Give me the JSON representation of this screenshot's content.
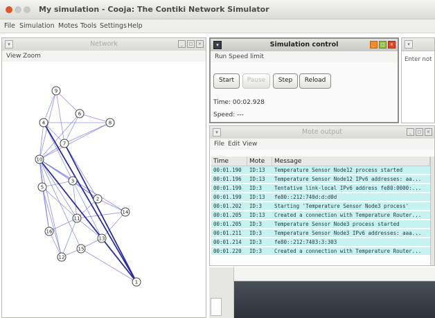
{
  "window": {
    "title": "My simulation - Cooja: The Contiki Network Simulator",
    "menu": [
      "File",
      "Simulation",
      "Motes",
      "Tools",
      "Settings",
      "Help"
    ]
  },
  "network": {
    "title": "Network",
    "menu": [
      "View",
      "Zoom"
    ],
    "node_labels": [
      "9",
      "6",
      "8",
      "4",
      "7",
      "10",
      "5",
      "3",
      "2",
      "11",
      "14",
      "16",
      "13",
      "12",
      "15",
      "1"
    ]
  },
  "simulation_control": {
    "title": "Simulation control",
    "menu": [
      "Run",
      "Speed limit"
    ],
    "buttons": {
      "start": "Start",
      "pause": "Pause",
      "step": "Step",
      "reload": "Reload"
    },
    "time": "Time: 00:02.928",
    "speed": "Speed: ---"
  },
  "notes": {
    "placeholder": "Enter not"
  },
  "mote_output": {
    "title": "Mote output",
    "menu": [
      "File",
      "Edit",
      "View"
    ],
    "columns": [
      "Time",
      "Mote",
      "Message"
    ],
    "rows": [
      [
        "00:01.190",
        "ID:13",
        "Temperature Sensor Node12 process started"
      ],
      [
        "00:01.196",
        "ID:13",
        "Temperature Sensor Node12 IPv6 addresses: aa..."
      ],
      [
        "00:01.199",
        "ID:3",
        "Tentative link-local IPv6 address fe80:0000:..."
      ],
      [
        "00:01.199",
        "ID:13",
        "fe80::212:740d:d:d0d"
      ],
      [
        "00:01.202",
        "ID:3",
        "Starting 'Temperature Sensor Node3 process'"
      ],
      [
        "00:01.205",
        "ID:13",
        "Created a connection with Temperature Router..."
      ],
      [
        "00:01.205",
        "ID:3",
        "Temperature Sensor Node3 process started"
      ],
      [
        "00:01.211",
        "ID:3",
        "Temperature Sensor Node3 IPv6 addresses: aaa..."
      ],
      [
        "00:01.214",
        "ID:3",
        "fe80::212:7403:3:303"
      ],
      [
        "00:01.220",
        "ID:3",
        "Created a connection with Temperature Router..."
      ]
    ]
  },
  "colors": {
    "row_bg": "#c6f2f0",
    "edge": "#6a6fd8",
    "edge_strong": "#2a2f9a",
    "dark_panel": "#3a4048"
  }
}
